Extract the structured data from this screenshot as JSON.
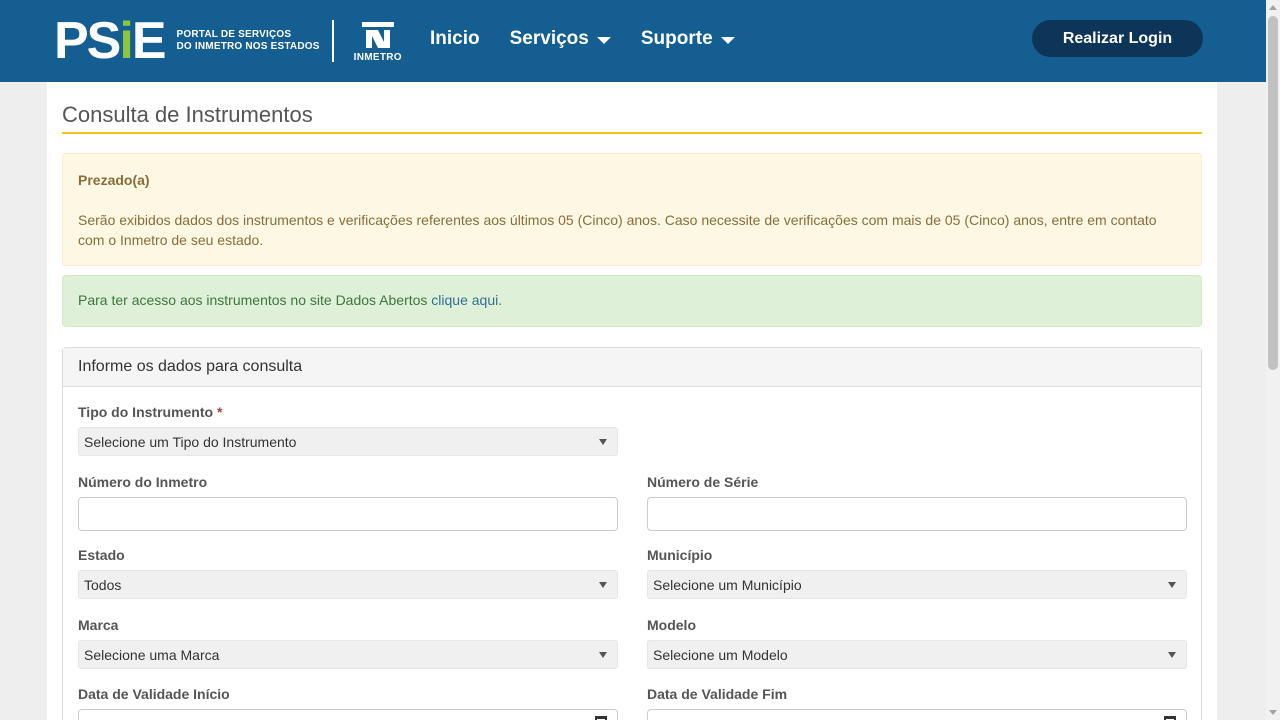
{
  "header": {
    "logo_text": "PSiE",
    "portal_line1": "PORTAL DE SERVIÇOS",
    "portal_line2": "DO INMETRO NOS ESTADOS",
    "inmetro_label": "INMETRO",
    "nav": [
      {
        "label": "Inicio"
      },
      {
        "label": "Serviços"
      },
      {
        "label": "Suporte"
      }
    ],
    "login_label": "Realizar Login",
    "colors": {
      "bar": "#155e91",
      "login": "#0c3558",
      "accent": "#8cc63f"
    }
  },
  "page": {
    "title": "Consulta de Instrumentos",
    "warning": {
      "heading": "Prezado(a)",
      "message": "Serão exibidos dados dos instrumentos e verificações referentes aos últimos 05 (Cinco) anos. Caso necessite de verificações com mais de 05 (Cinco) anos, entre em contato com o Inmetro de seu estado."
    },
    "info": {
      "text": "Para ter acesso aos instrumentos no site Dados Abertos ",
      "link": "clique aqui",
      "suffix": "."
    }
  },
  "form": {
    "panel_title": "Informe os dados para consulta",
    "tipo_label": "Tipo do Instrumento",
    "required_mark": "*",
    "tipo_value": "Selecione um Tipo do Instrumento",
    "numero_inmetro_label": "Número do Inmetro",
    "numero_serie_label": "Número de Série",
    "estado_label": "Estado",
    "estado_value": "Todos",
    "municipio_label": "Município",
    "municipio_value": "Selecione um Município",
    "marca_label": "Marca",
    "marca_value": "Selecione uma Marca",
    "modelo_label": "Modelo",
    "modelo_value": "Selecione um Modelo",
    "data_inicio_label": "Data de Validade Início",
    "data_fim_label": "Data de Validade Fim"
  }
}
